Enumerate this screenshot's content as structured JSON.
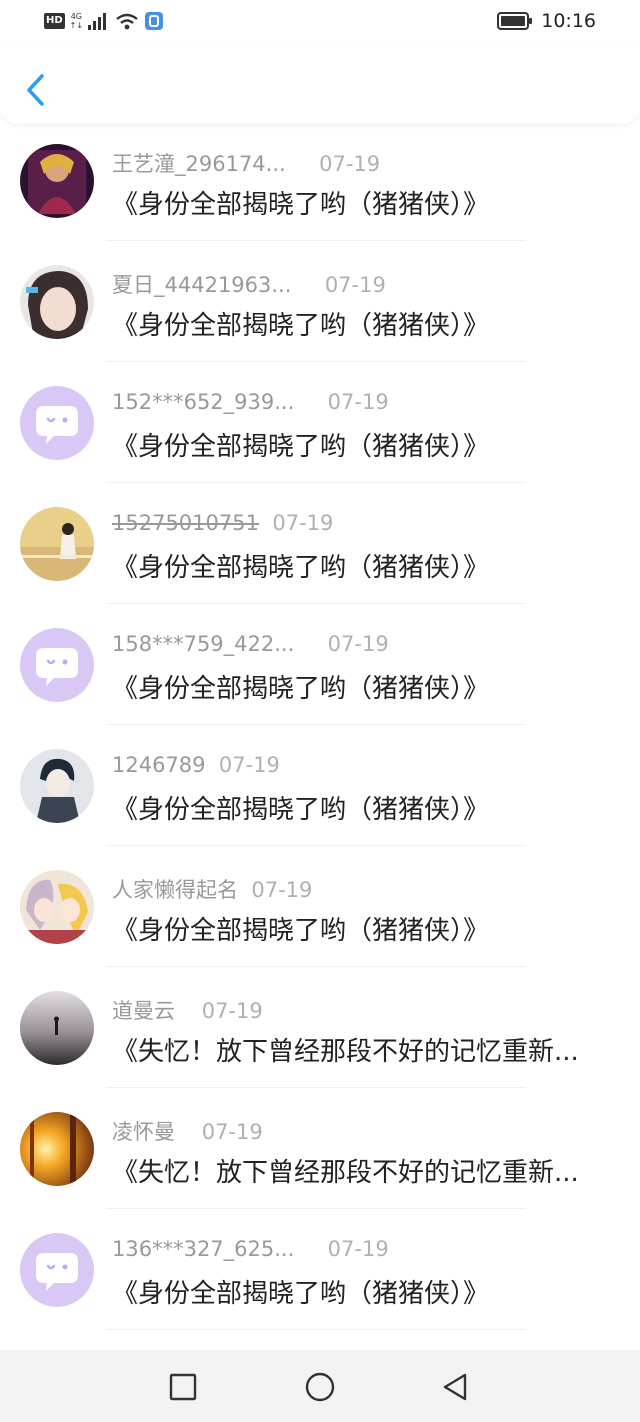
{
  "status_bar": {
    "hd": "HD",
    "network_type": "4G",
    "network_sub": "↑↓",
    "time": "10:16"
  },
  "header": {
    "back_icon": "chevron-left-icon",
    "accent_color": "#2a9df4"
  },
  "messages": [
    {
      "user": "王艺潼_296174...",
      "date": "07-19",
      "title": "《身份全部揭晓了哟（猪猪侠）》",
      "avatar": "photo"
    },
    {
      "user": "夏日_44421963...",
      "date": "07-19",
      "title": "《身份全部揭晓了哟（猪猪侠）》",
      "avatar": "photo"
    },
    {
      "user": "152***652_939...",
      "date": "07-19",
      "title": "《身份全部揭晓了哟（猪猪侠）》",
      "avatar": "default-chat-bubble"
    },
    {
      "user": "15275010751",
      "date": "07-19",
      "title": "《身份全部揭晓了哟（猪猪侠）》",
      "avatar": "photo"
    },
    {
      "user": "158***759_422...",
      "date": "07-19",
      "title": "《身份全部揭晓了哟（猪猪侠）》",
      "avatar": "default-chat-bubble"
    },
    {
      "user": "1246789",
      "date": "07-19",
      "title": "《身份全部揭晓了哟（猪猪侠）》",
      "avatar": "photo"
    },
    {
      "user": "人家懒得起名",
      "date": "07-19",
      "title": "《身份全部揭晓了哟（猪猪侠）》",
      "avatar": "photo"
    },
    {
      "user": "道曼云",
      "date": "07-19",
      "title": "《失忆！放下曾经那段不好的记忆重新...",
      "avatar": "photo"
    },
    {
      "user": "凌怀曼",
      "date": "07-19",
      "title": "《失忆！放下曾经那段不好的记忆重新...",
      "avatar": "photo"
    },
    {
      "user": "136***327_625...",
      "date": "07-19",
      "title": "《身份全部揭晓了哟（猪猪侠）》",
      "avatar": "default-chat-bubble"
    }
  ],
  "nav_bar": {
    "icons": [
      "square-recents-icon",
      "circle-home-icon",
      "triangle-back-icon"
    ]
  },
  "colors": {
    "default_avatar_bg": "#d9c8f5",
    "default_avatar_bubble": "#ffffff"
  }
}
